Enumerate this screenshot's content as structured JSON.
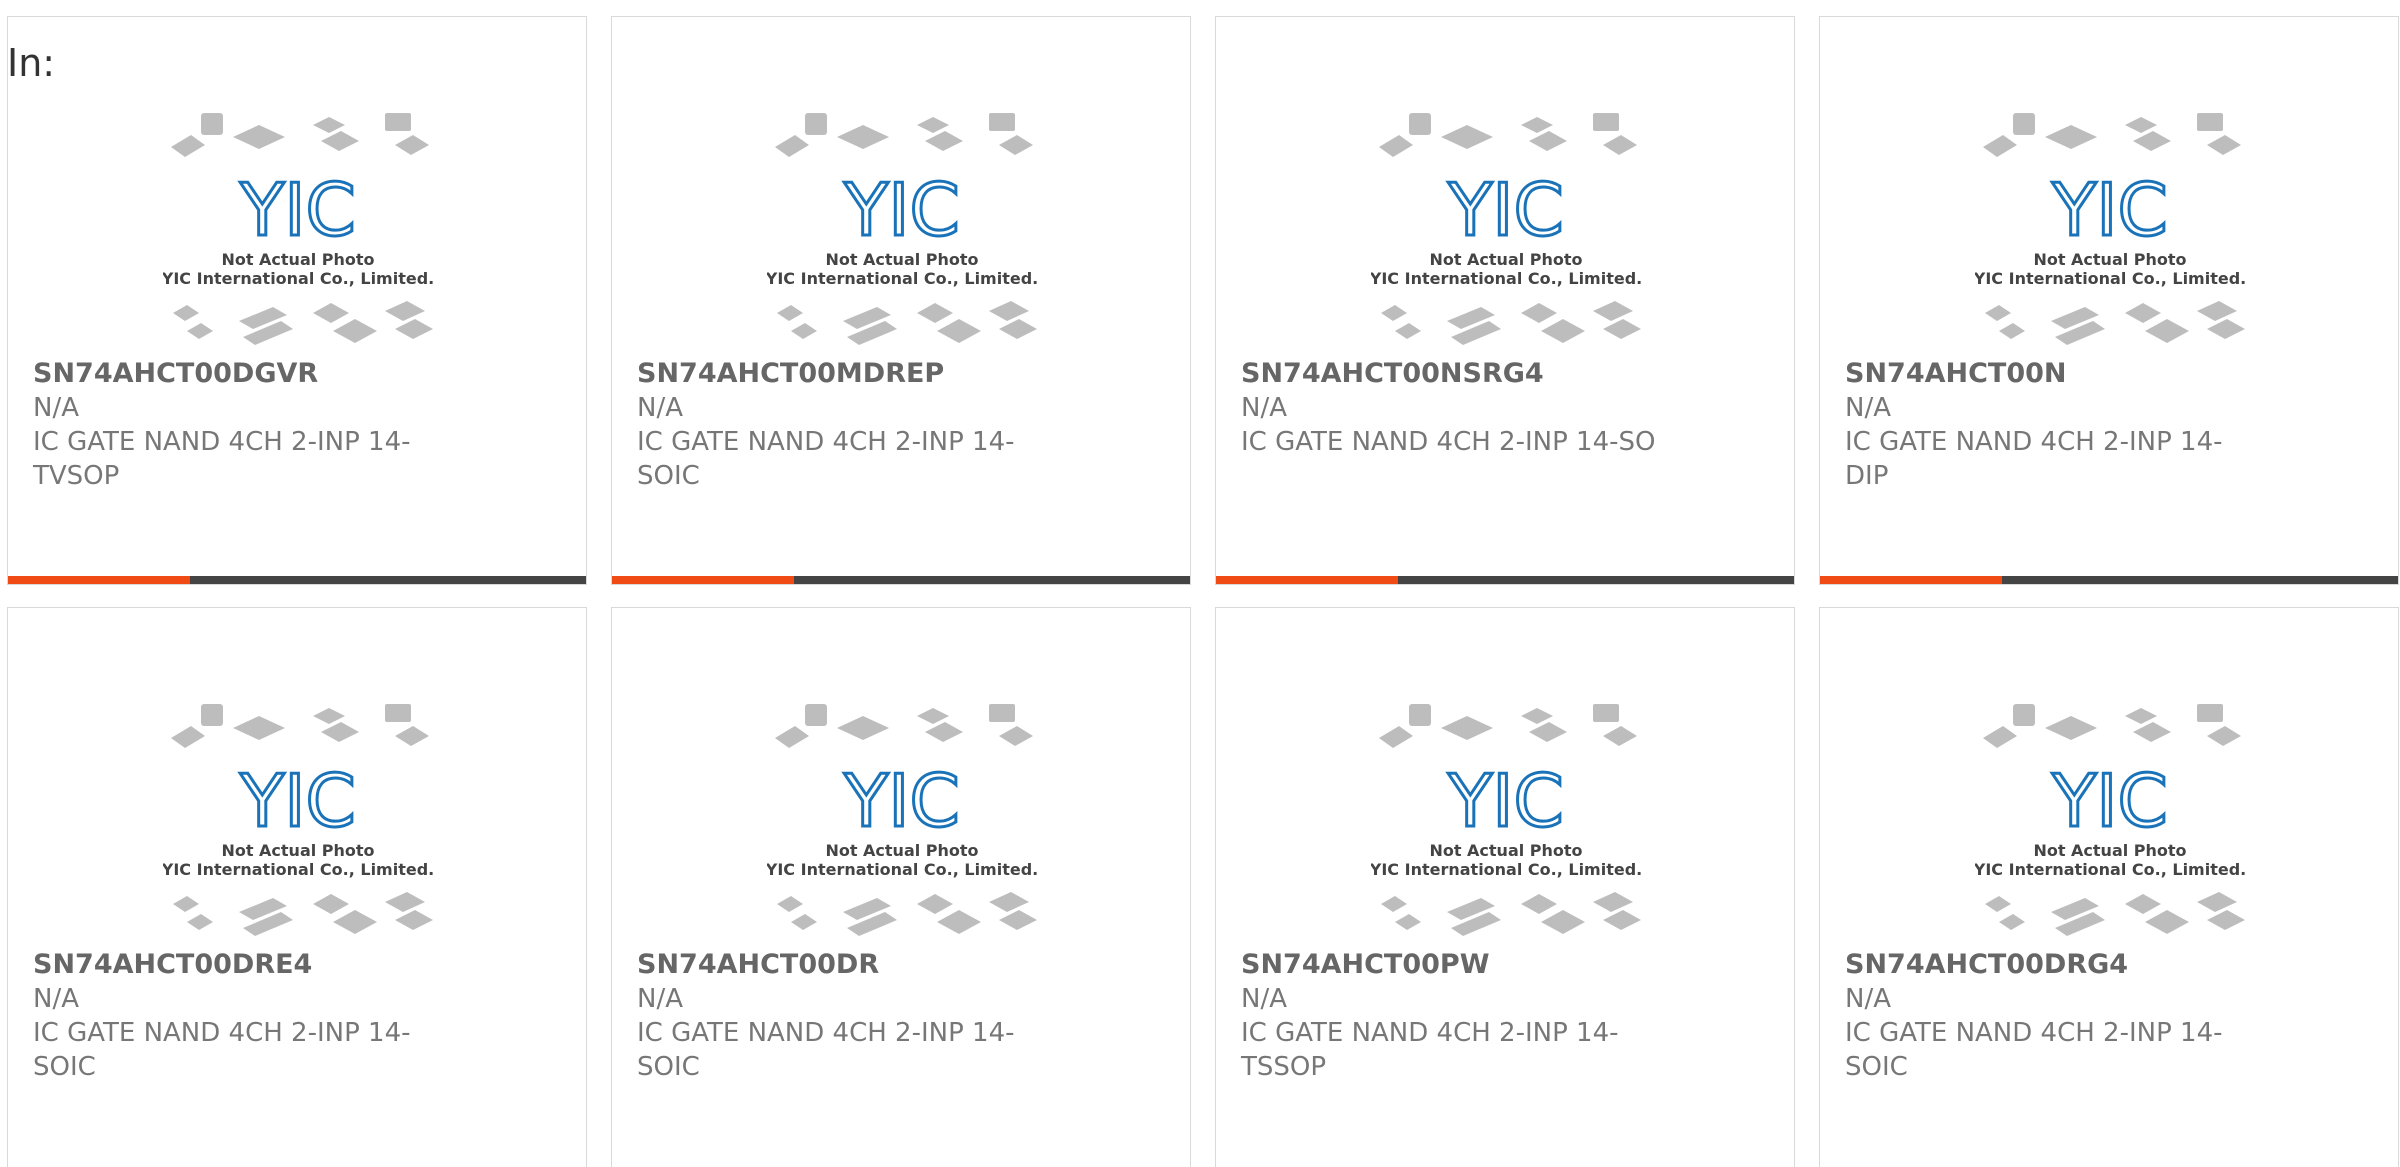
{
  "header": {
    "in_label": "In:"
  },
  "image": {
    "line1": "Not Actual Photo",
    "line2": "YIC International Co., Limited.",
    "logo_text": "YIC"
  },
  "colors": {
    "accent": "#f04a15",
    "dark": "#444444",
    "logo": "#1a73b8",
    "chip": "#bdbdbd"
  },
  "products": [
    {
      "part": "SN74AHCT00DGVR",
      "manufacturer": "N/A",
      "desc1": "IC GATE NAND 4CH 2-INP 14-",
      "desc2": "TVSOP"
    },
    {
      "part": "SN74AHCT00MDREP",
      "manufacturer": "N/A",
      "desc1": "IC GATE NAND 4CH 2-INP 14-",
      "desc2": "SOIC"
    },
    {
      "part": "SN74AHCT00NSRG4",
      "manufacturer": "N/A",
      "desc1": "IC GATE NAND 4CH 2-INP 14-SO",
      "desc2": ""
    },
    {
      "part": "SN74AHCT00N",
      "manufacturer": "N/A",
      "desc1": "IC GATE NAND 4CH 2-INP 14-DIP",
      "desc2": ""
    },
    {
      "part": "SN74AHCT00DRE4",
      "manufacturer": "N/A",
      "desc1": "IC GATE NAND 4CH 2-INP 14-",
      "desc2": "SOIC"
    },
    {
      "part": "SN74AHCT00DR",
      "manufacturer": "N/A",
      "desc1": "IC GATE NAND 4CH 2-INP 14-",
      "desc2": "SOIC"
    },
    {
      "part": "SN74AHCT00PW",
      "manufacturer": "N/A",
      "desc1": "IC GATE NAND 4CH 2-INP 14-",
      "desc2": "TSSOP"
    },
    {
      "part": "SN74AHCT00DRG4",
      "manufacturer": "N/A",
      "desc1": "IC GATE NAND 4CH 2-INP 14-",
      "desc2": "SOIC"
    }
  ]
}
